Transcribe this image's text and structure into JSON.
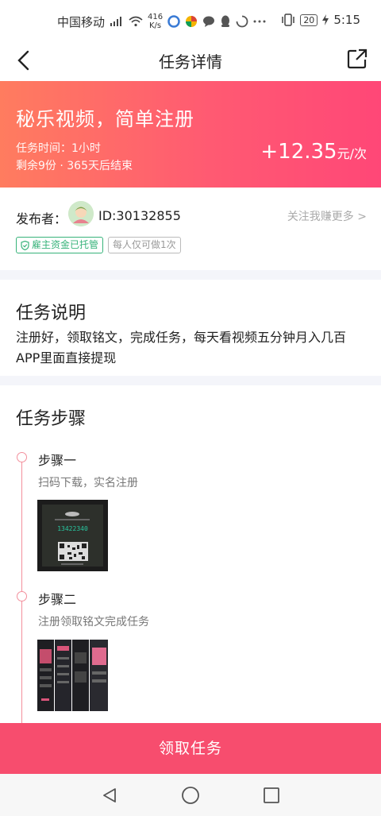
{
  "status_bar": {
    "carrier": "中国移动",
    "signal": "⁴ᴳ",
    "net_speed_value": "416",
    "net_speed_unit": "K/s",
    "battery": "20",
    "time": "5:15"
  },
  "nav": {
    "title": "任务详情"
  },
  "hero": {
    "title": "秘乐视频，简单注册",
    "time_text": "任务时间：1小时",
    "remain_text": "剩余9份 · 365天后结束",
    "price": "+12.35",
    "price_unit": "元/次"
  },
  "publisher": {
    "label": "发布者：",
    "id": "ID:30132855",
    "follow_text": "关注我赚更多 >",
    "tags": [
      "雇主资金已托管",
      "每人仅可做1次"
    ]
  },
  "description": {
    "title": "任务说明",
    "text": "注册好，领取铭文，完成任务，每天看视频五分钟月入几百APP里面直接提现"
  },
  "steps": {
    "title": "任务步骤",
    "items": [
      {
        "title": "步骤一",
        "subtitle": "扫码下载，实名注册",
        "image_text": "13422340"
      },
      {
        "title": "步骤二",
        "subtitle": "注册领取铭文完成任务"
      }
    ]
  },
  "cta": {
    "label": "领取任务"
  },
  "colors": {
    "accent": "#f74d6e",
    "hero_start": "#ff7c5f",
    "hero_end": "#ff4777",
    "green": "#37b37a",
    "timeline": "#f38f9c"
  }
}
